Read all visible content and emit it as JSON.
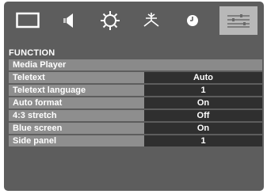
{
  "tabs": [
    {
      "icon": "picture-icon",
      "active": false
    },
    {
      "icon": "sound-icon",
      "active": false
    },
    {
      "icon": "setup-icon",
      "active": false
    },
    {
      "icon": "installation-icon",
      "active": false
    },
    {
      "icon": "timer-icon",
      "active": false
    },
    {
      "icon": "function-icon",
      "active": true
    }
  ],
  "section_title": "FUNCTION",
  "menu": {
    "items": [
      {
        "label": "Media Player",
        "value": null
      },
      {
        "label": "Teletext",
        "value": "Auto"
      },
      {
        "label": "Teletext language",
        "value": "1"
      },
      {
        "label": "Auto format",
        "value": "On"
      },
      {
        "label": "4:3 stretch",
        "value": "Off"
      },
      {
        "label": "Blue screen",
        "value": "On"
      },
      {
        "label": "Side panel",
        "value": "1"
      }
    ]
  },
  "colors": {
    "panel_bg": "#5d5d5d",
    "label_bg": "#8e8e8e",
    "value_bg": "#2f2f2f",
    "active_tab_bg": "#b8b8b8",
    "text": "#ffffff"
  }
}
